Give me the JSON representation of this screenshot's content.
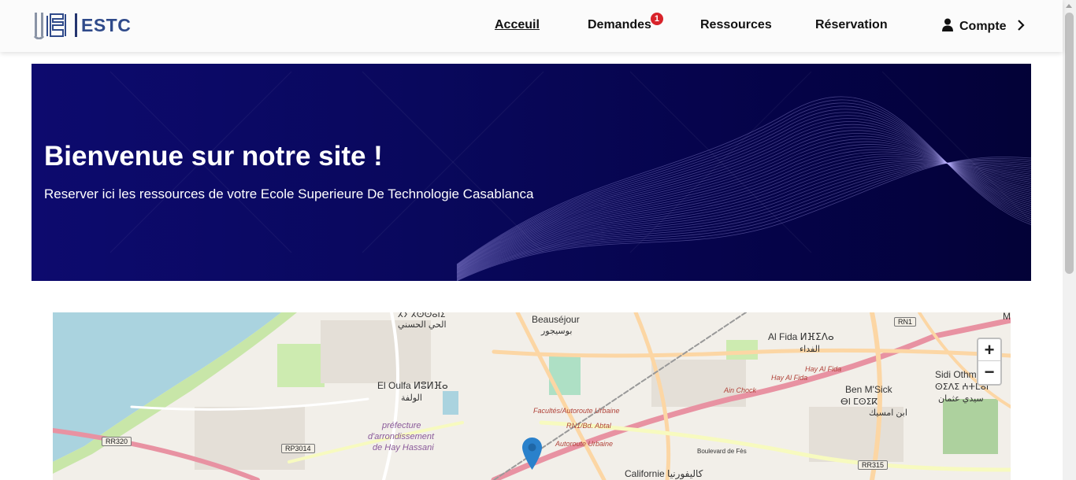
{
  "nav": {
    "logo_text": "ESTC",
    "links": [
      {
        "label": "Acceuil"
      },
      {
        "label": "Demandes"
      },
      {
        "label": "Ressources"
      },
      {
        "label": "Réservation"
      }
    ],
    "demandes_badge": "1",
    "account_label": "Compte"
  },
  "hero": {
    "title": "Bienvenue sur notre site !",
    "subtitle": "Reserver ici les ressources de votre Ecole Superieure De Technologie Casablanca"
  },
  "map": {
    "zoom_in": "+",
    "zoom_out": "−",
    "labels": {
      "beausejour": "Beauséjour",
      "beausejour_ar": "بوسيجور",
      "hay_hassani_top": "ⵃⵢ ⵃⵙⵙⴰⵏⵉ",
      "hay_hassani_top_ar": "الحي الحسني",
      "el_oulfa": "El Oulfa ⵍⵓⵍⴼⴰ",
      "el_oulfa_ar": "الولفة",
      "al_fida": "Al Fida ⵍⴼⵉⴷⴰ",
      "al_fida_ar": "الفداء",
      "hay_al_fida_1": "Hay Al Fida",
      "hay_al_fida_2": "Hay Al Fida",
      "ain_chock": "Ain Chock",
      "ben_msick": "Ben M'Sick",
      "ben_msick_tif": "ⴱⵏ ⵎⵙⵉⴽ",
      "ben_msick_ar": "ابن امسيك",
      "sidi_othman": "Sidi Othm",
      "sidi_othman_tif": "ⵙⵉⴷⵉ ⵄⵜⵎⴰⵏ",
      "sidi_othman_ar": "سيدي عثمان",
      "facultes": "Facultés/Autoroute Urbaine",
      "rn1_abtal": "RN1/Bd. Abtal",
      "autoroute": "Autoroute Urbaine",
      "prefecture_1": "préfecture",
      "prefecture_2": "d'arrondissement",
      "prefecture_3": "de Hay Hassani",
      "boulevard_fes": "Boulevard de Fès",
      "californie": "Californie كاليفورنيا",
      "rr320": "RR320",
      "rp3014": "RP3014",
      "rn1": "RN1",
      "rr315": "RR315",
      "m": "M"
    }
  },
  "colors": {
    "navbar_bg": "#fbfbfb",
    "hero_bg": "#09085c",
    "badge": "#d8232a",
    "logo_blue": "#2f4a8a",
    "marker": "#2a81cb"
  }
}
